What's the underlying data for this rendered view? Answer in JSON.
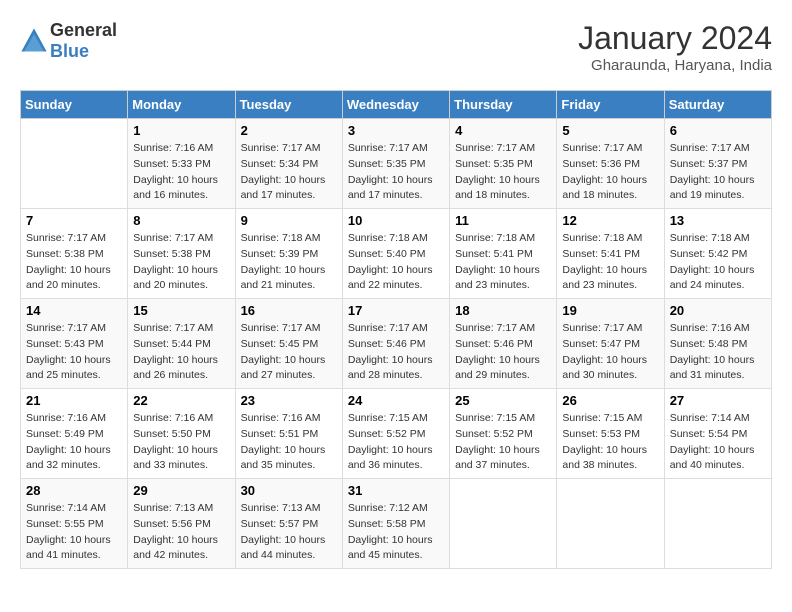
{
  "header": {
    "logo_general": "General",
    "logo_blue": "Blue",
    "month_title": "January 2024",
    "location": "Gharaunda, Haryana, India"
  },
  "days_of_week": [
    "Sunday",
    "Monday",
    "Tuesday",
    "Wednesday",
    "Thursday",
    "Friday",
    "Saturday"
  ],
  "weeks": [
    [
      {
        "day": "",
        "sunrise": "",
        "sunset": "",
        "daylight": ""
      },
      {
        "day": "1",
        "sunrise": "7:16 AM",
        "sunset": "5:33 PM",
        "daylight": "10 hours and 16 minutes."
      },
      {
        "day": "2",
        "sunrise": "7:17 AM",
        "sunset": "5:34 PM",
        "daylight": "10 hours and 17 minutes."
      },
      {
        "day": "3",
        "sunrise": "7:17 AM",
        "sunset": "5:35 PM",
        "daylight": "10 hours and 17 minutes."
      },
      {
        "day": "4",
        "sunrise": "7:17 AM",
        "sunset": "5:35 PM",
        "daylight": "10 hours and 18 minutes."
      },
      {
        "day": "5",
        "sunrise": "7:17 AM",
        "sunset": "5:36 PM",
        "daylight": "10 hours and 18 minutes."
      },
      {
        "day": "6",
        "sunrise": "7:17 AM",
        "sunset": "5:37 PM",
        "daylight": "10 hours and 19 minutes."
      }
    ],
    [
      {
        "day": "7",
        "sunrise": "7:17 AM",
        "sunset": "5:38 PM",
        "daylight": "10 hours and 20 minutes."
      },
      {
        "day": "8",
        "sunrise": "7:17 AM",
        "sunset": "5:38 PM",
        "daylight": "10 hours and 20 minutes."
      },
      {
        "day": "9",
        "sunrise": "7:18 AM",
        "sunset": "5:39 PM",
        "daylight": "10 hours and 21 minutes."
      },
      {
        "day": "10",
        "sunrise": "7:18 AM",
        "sunset": "5:40 PM",
        "daylight": "10 hours and 22 minutes."
      },
      {
        "day": "11",
        "sunrise": "7:18 AM",
        "sunset": "5:41 PM",
        "daylight": "10 hours and 23 minutes."
      },
      {
        "day": "12",
        "sunrise": "7:18 AM",
        "sunset": "5:41 PM",
        "daylight": "10 hours and 23 minutes."
      },
      {
        "day": "13",
        "sunrise": "7:18 AM",
        "sunset": "5:42 PM",
        "daylight": "10 hours and 24 minutes."
      }
    ],
    [
      {
        "day": "14",
        "sunrise": "7:17 AM",
        "sunset": "5:43 PM",
        "daylight": "10 hours and 25 minutes."
      },
      {
        "day": "15",
        "sunrise": "7:17 AM",
        "sunset": "5:44 PM",
        "daylight": "10 hours and 26 minutes."
      },
      {
        "day": "16",
        "sunrise": "7:17 AM",
        "sunset": "5:45 PM",
        "daylight": "10 hours and 27 minutes."
      },
      {
        "day": "17",
        "sunrise": "7:17 AM",
        "sunset": "5:46 PM",
        "daylight": "10 hours and 28 minutes."
      },
      {
        "day": "18",
        "sunrise": "7:17 AM",
        "sunset": "5:46 PM",
        "daylight": "10 hours and 29 minutes."
      },
      {
        "day": "19",
        "sunrise": "7:17 AM",
        "sunset": "5:47 PM",
        "daylight": "10 hours and 30 minutes."
      },
      {
        "day": "20",
        "sunrise": "7:16 AM",
        "sunset": "5:48 PM",
        "daylight": "10 hours and 31 minutes."
      }
    ],
    [
      {
        "day": "21",
        "sunrise": "7:16 AM",
        "sunset": "5:49 PM",
        "daylight": "10 hours and 32 minutes."
      },
      {
        "day": "22",
        "sunrise": "7:16 AM",
        "sunset": "5:50 PM",
        "daylight": "10 hours and 33 minutes."
      },
      {
        "day": "23",
        "sunrise": "7:16 AM",
        "sunset": "5:51 PM",
        "daylight": "10 hours and 35 minutes."
      },
      {
        "day": "24",
        "sunrise": "7:15 AM",
        "sunset": "5:52 PM",
        "daylight": "10 hours and 36 minutes."
      },
      {
        "day": "25",
        "sunrise": "7:15 AM",
        "sunset": "5:52 PM",
        "daylight": "10 hours and 37 minutes."
      },
      {
        "day": "26",
        "sunrise": "7:15 AM",
        "sunset": "5:53 PM",
        "daylight": "10 hours and 38 minutes."
      },
      {
        "day": "27",
        "sunrise": "7:14 AM",
        "sunset": "5:54 PM",
        "daylight": "10 hours and 40 minutes."
      }
    ],
    [
      {
        "day": "28",
        "sunrise": "7:14 AM",
        "sunset": "5:55 PM",
        "daylight": "10 hours and 41 minutes."
      },
      {
        "day": "29",
        "sunrise": "7:13 AM",
        "sunset": "5:56 PM",
        "daylight": "10 hours and 42 minutes."
      },
      {
        "day": "30",
        "sunrise": "7:13 AM",
        "sunset": "5:57 PM",
        "daylight": "10 hours and 44 minutes."
      },
      {
        "day": "31",
        "sunrise": "7:12 AM",
        "sunset": "5:58 PM",
        "daylight": "10 hours and 45 minutes."
      },
      {
        "day": "",
        "sunrise": "",
        "sunset": "",
        "daylight": ""
      },
      {
        "day": "",
        "sunrise": "",
        "sunset": "",
        "daylight": ""
      },
      {
        "day": "",
        "sunrise": "",
        "sunset": "",
        "daylight": ""
      }
    ]
  ],
  "labels": {
    "sunrise": "Sunrise:",
    "sunset": "Sunset:",
    "daylight": "Daylight:"
  }
}
